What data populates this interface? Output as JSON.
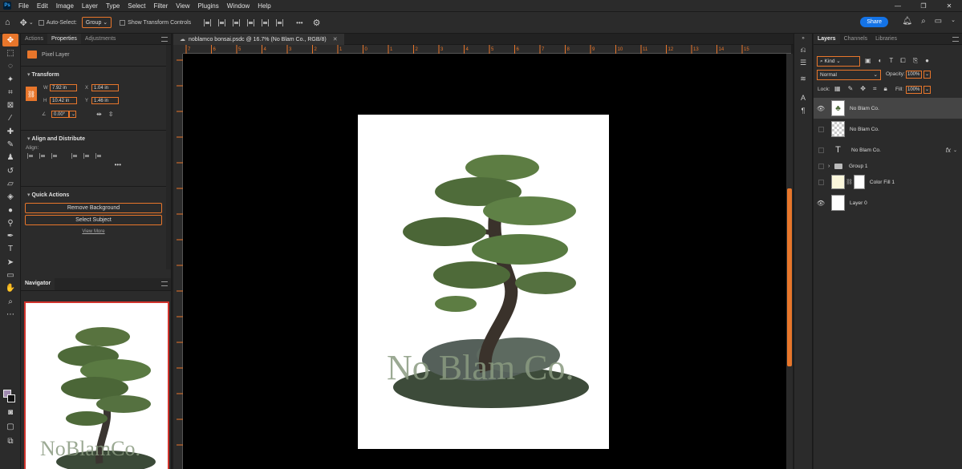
{
  "menubar": {
    "logo": "Ps",
    "items": [
      "File",
      "Edit",
      "Image",
      "Layer",
      "Type",
      "Select",
      "Filter",
      "View",
      "Plugins",
      "Window",
      "Help"
    ]
  },
  "options": {
    "auto_select_label": "Auto-Select:",
    "group_select": "Group",
    "show_transform_label": "Show Transform Controls",
    "more": "•••",
    "share_label": "Share"
  },
  "properties": {
    "tabs": [
      "Actions",
      "Properties",
      "Adjustments"
    ],
    "layer_type": "Pixel Layer",
    "transform_title": "Transform",
    "w_label": "W",
    "w_value": "7.92 in",
    "h_label": "H",
    "h_value": "10.42 in",
    "x_label": "X",
    "x_value": "1.04 in",
    "y_label": "Y",
    "y_value": "1.46 in",
    "angle_value": "0.00°",
    "align_title": "Align and Distribute",
    "align_label": "Align:",
    "quick_actions_title": "Quick Actions",
    "remove_bg": "Remove Background",
    "select_subject": "Select Subject",
    "view_more": "View More"
  },
  "navigator": {
    "title": "Navigator",
    "watermark": "NoBlamCo."
  },
  "document": {
    "tab_title": "noblamco bonsai.psdc @ 16.7% (No Blam Co., RGB/8)",
    "watermark": "No Blam Co."
  },
  "ruler_ticks": [
    "7",
    "6",
    "5",
    "4",
    "3",
    "2",
    "1",
    "0",
    "1",
    "2",
    "3",
    "4",
    "5",
    "6",
    "7",
    "8",
    "9",
    "10",
    "11",
    "12",
    "13",
    "14",
    "15"
  ],
  "layers": {
    "tabs": [
      "Layers",
      "Channels",
      "Libraries"
    ],
    "kind": "Kind",
    "blend_mode": "Normal",
    "opacity_label": "Opacity:",
    "opacity_value": "100%",
    "lock_label": "Lock:",
    "fill_label": "Fill:",
    "fill_value": "100%",
    "rows": [
      {
        "name": "No Blam Co."
      },
      {
        "name": "No Blam Co."
      },
      {
        "name": "No Blam Co."
      },
      {
        "name": "Group 1"
      },
      {
        "name": "Color Fill 1"
      },
      {
        "name": "Layer 0"
      }
    ]
  },
  "colors": {
    "accent": "#e8762b",
    "share": "#1473e6",
    "foreground_swatch": "#a08ab0"
  }
}
